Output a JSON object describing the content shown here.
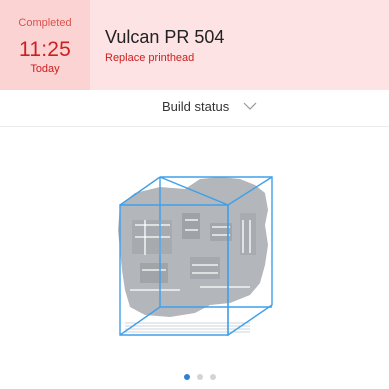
{
  "job": {
    "status": "Completed",
    "time": "11:25",
    "day": "Today"
  },
  "printer": {
    "name": "Vulcan PR 504",
    "message": "Replace printhead"
  },
  "build_status": {
    "label": "Build status",
    "icon": "chevron-down-icon"
  },
  "preview": {
    "icon": "build-volume-preview",
    "slide_count": 3,
    "active_slide": 1
  },
  "colors": {
    "alert_red": "#cc1f1f",
    "header_bg": "#fde3e3",
    "time_bg": "#fbd3d3",
    "box_blue": "#3ea0ea",
    "model_gray": "#b3b6ba",
    "dot_active": "#2f7fd6",
    "dot_inactive": "#d4d4d4"
  }
}
